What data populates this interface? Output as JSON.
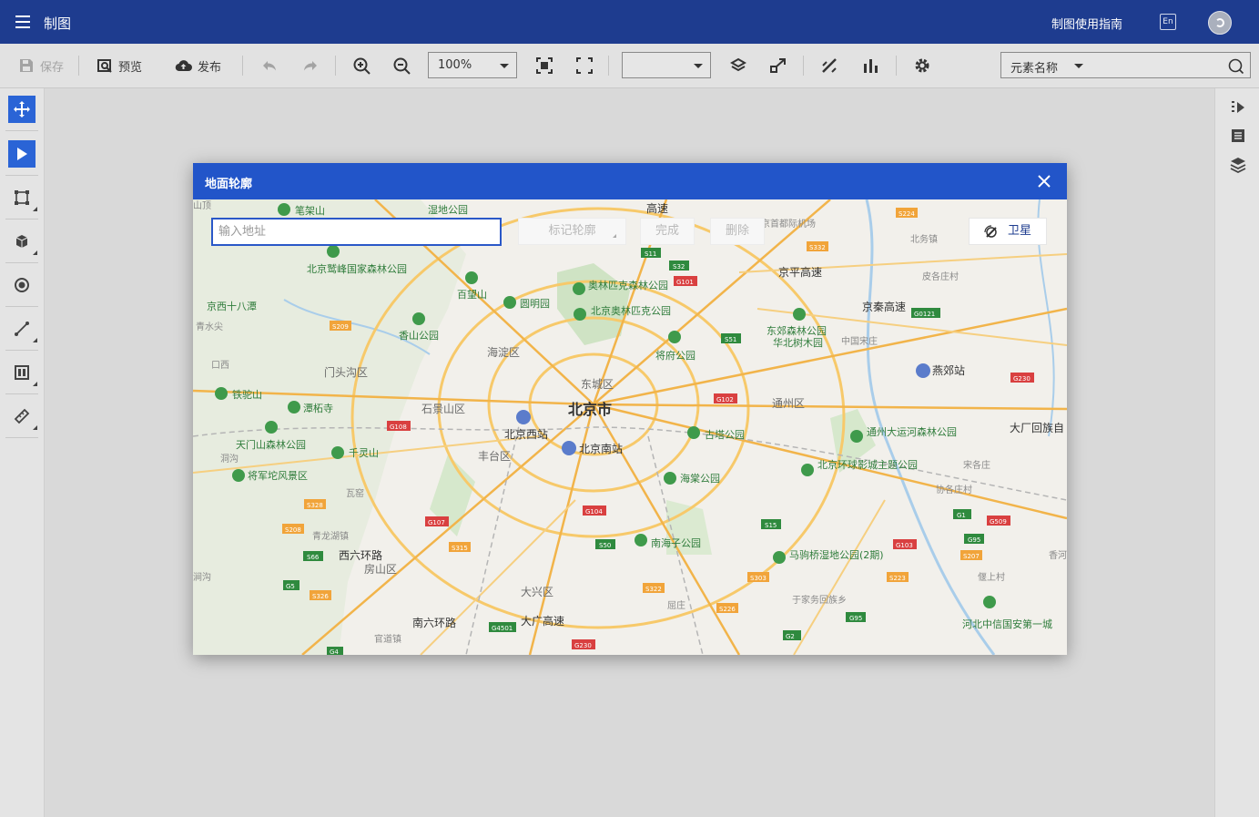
{
  "app": {
    "title": "制图",
    "guide_link": "制图使用指南",
    "lang_badge": "En"
  },
  "toolbar": {
    "save_label": "保存",
    "preview_label": "预览",
    "publish_label": "发布",
    "zoom_value": "100%",
    "layer_select_value": "",
    "search_type": "元素名称"
  },
  "modal": {
    "title": "地面轮廓",
    "address_placeholder": "输入地址",
    "mark_contour_label": "标记轮廓",
    "done_label": "完成",
    "delete_label": "删除",
    "satellite_label": "卫星"
  },
  "map": {
    "city_label": "北京市",
    "districts": [
      "海淀区",
      "东城区",
      "石景山区",
      "丰台区",
      "通州区",
      "门头沟区",
      "房山区",
      "大兴区"
    ],
    "pois": [
      "笔架山",
      "北京鹫峰国家森林公园",
      "百望山",
      "圆明园",
      "奥林匹克森林公园",
      "北京奥林匹克公园",
      "香山公园",
      "将府公园",
      "东郊森林公园",
      "华北树木园",
      "铁驼山",
      "潭柘寺",
      "天门山森林公园",
      "千灵山",
      "将军坨风景区",
      "古塔公园",
      "海棠公园",
      "南海子公园",
      "马驹桥湿地公园(2期)",
      "通州大运河森林公园",
      "北京环球影城主题公园",
      "河北中信国安第一城",
      "湿地公园",
      "京西十八潭"
    ],
    "stations": [
      "北京西站",
      "北京南站",
      "燕郊站",
      "京首都际机场"
    ],
    "roads": [
      "京平高速",
      "京秦高速",
      "南六环路",
      "西六环路",
      "大广高速",
      "高速"
    ],
    "places": [
      "北务镇",
      "皮各庄村",
      "中国宋庄",
      "大厂回族自",
      "宋各庄",
      "协各庄村",
      "香河",
      "偃上村",
      "屈庄",
      "于家务回族乡",
      "官道镇",
      "瓦窑",
      "青龙湖镇",
      "青水尖",
      "口西",
      "洞沟",
      "涧沟",
      "山顶"
    ],
    "highway_shields": [
      "S11",
      "S32",
      "G101",
      "S51",
      "S224",
      "S332",
      "G0121",
      "G102",
      "G230",
      "S209",
      "G108",
      "S328",
      "S208",
      "G107",
      "S315",
      "S66",
      "G5",
      "S326",
      "G104",
      "S50",
      "G4501",
      "G230",
      "S322",
      "S226",
      "S15",
      "S303",
      "S223",
      "G103",
      "G1",
      "G509",
      "G95",
      "S207",
      "G2",
      "G95",
      "G4"
    ]
  },
  "colors": {
    "topbar": "#1e3c8f",
    "modal_header": "#2255c9",
    "active_tool": "#2a64d6"
  }
}
